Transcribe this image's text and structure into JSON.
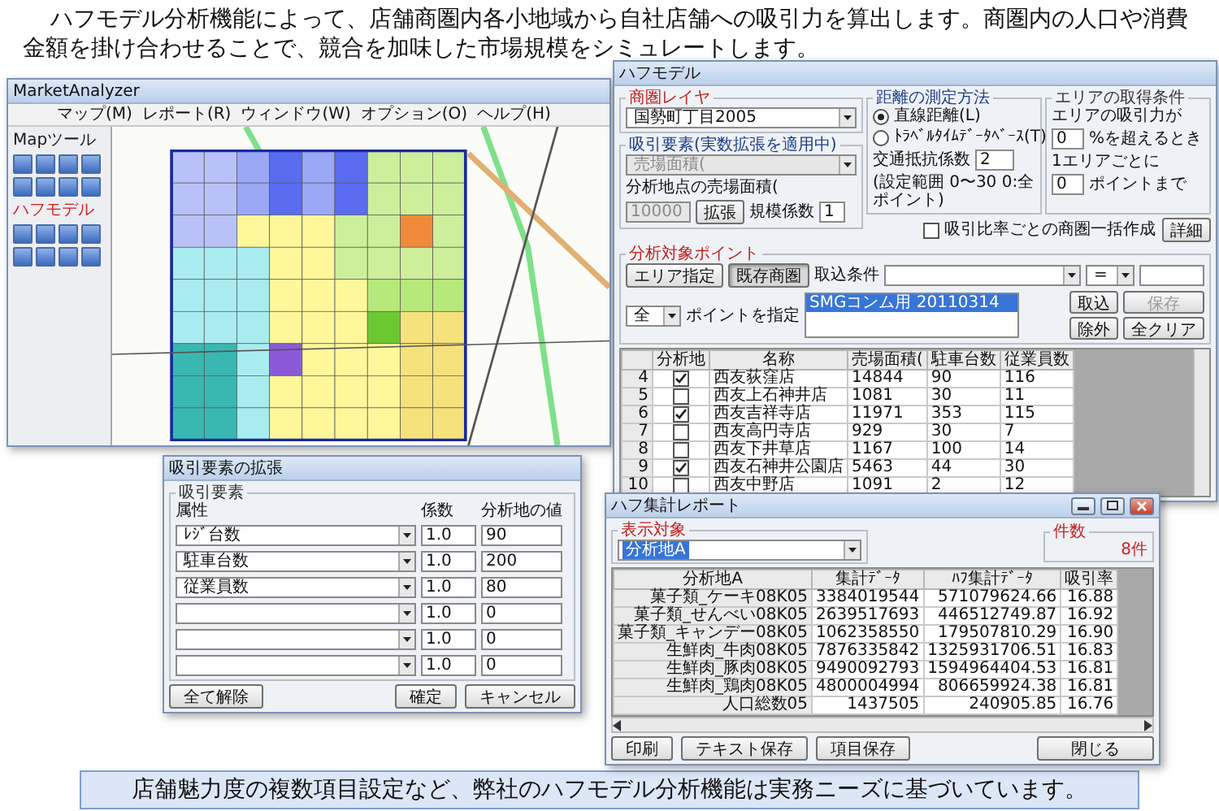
{
  "intro": "ハフモデル分析機能によって、店舗商圏内各小地域から自社店舗への吸引力を算出します。商圏内の人口や消費金額を掛け合わせることで、競合を加味した市場規模をシミュレートします。",
  "app_window": {
    "title": "MarketAnalyzer",
    "menu": [
      "マップ(M)",
      "レポート(R)",
      "ウィンドウ(W)",
      "オプション(O)",
      "ヘルプ(H)"
    ],
    "sidebar": [
      {
        "label": "Mapツール",
        "color": "#1a1a1a"
      },
      {
        "label": "ハフモデル",
        "color": "#d02020"
      }
    ]
  },
  "huff_dialog": {
    "title": "ハフモデル",
    "layer": {
      "legend": "商圏レイヤ",
      "value": "国勢町丁目2005"
    },
    "attraction": {
      "legend": "吸引要素(実数拡張を適用中)",
      "select_value": "売場面積(",
      "select_disabled": true,
      "area_label": "分析地点の売場面積(",
      "area_value": "10000",
      "area_disabled": true,
      "extend_button": "拡張",
      "scale_label": "規模係数",
      "scale_value": "1"
    },
    "distance": {
      "legend": "距離の測定方法",
      "options": [
        {
          "label": "直線距離(L)",
          "selected": true
        },
        {
          "label": "ﾄﾗﾍﾞﾙﾀｲﾑﾃﾞｰﾀﾍﾞｰｽ(T)",
          "selected": false
        }
      ],
      "resistance_label": "交通抵抗係数",
      "resistance_value": "2",
      "note": "(設定範囲 0〜30 0:全ポイント)"
    },
    "area_conditions": {
      "legend": "エリアの取得条件",
      "rows": [
        {
          "label": "エリアの吸引力が",
          "value": "0",
          "suffix": "%を超えるとき"
        },
        {
          "label": "1エリアごとに",
          "value": "0",
          "suffix": "ポイントまで"
        }
      ],
      "batch": {
        "label": "吸引比率ごとの商圏一括作成",
        "checked": false
      },
      "detail_button": "詳細"
    },
    "points": {
      "legend": "分析対象ポイント",
      "modes": [
        {
          "label": "エリア指定",
          "selected": false
        },
        {
          "label": "既存商圏",
          "selected": true
        }
      ],
      "condition_label": "取込条件",
      "operator": "=",
      "filter": "全",
      "filter_label": "ポイントを指定",
      "list": [
        {
          "label": "SMGコンム用 20110314",
          "selected": true
        }
      ],
      "buttons": [
        {
          "label": "取込",
          "disabled": false
        },
        {
          "label": "保存",
          "disabled": true
        },
        {
          "label": "除外",
          "disabled": false
        },
        {
          "label": "全クリア",
          "disabled": false
        }
      ]
    },
    "table": {
      "columns": [
        "",
        "分析地",
        "名称",
        "売場面積(",
        "駐車台数",
        "従業員数"
      ],
      "rows": [
        {
          "index": "4",
          "site": {
            "checked": true
          },
          "name": "西友荻窪店",
          "area": "14844",
          "parking": "90",
          "staff": "116"
        },
        {
          "index": "5",
          "site": {
            "checked": false
          },
          "name": "西友上石神井店",
          "area": "1081",
          "parking": "30",
          "staff": "11"
        },
        {
          "index": "6",
          "site": {
            "checked": true
          },
          "name": "西友吉祥寺店",
          "area": "11971",
          "parking": "353",
          "staff": "115"
        },
        {
          "index": "7",
          "site": {
            "checked": false
          },
          "name": "西友高円寺店",
          "area": "929",
          "parking": "30",
          "staff": "7"
        },
        {
          "index": "8",
          "site": {
            "checked": false
          },
          "name": "西友下井草店",
          "area": "1167",
          "parking": "100",
          "staff": "14"
        },
        {
          "index": "9",
          "site": {
            "checked": true
          },
          "name": "西友石神井公園店",
          "area": "5463",
          "parking": "44",
          "staff": "30"
        },
        {
          "index": "10",
          "site": {
            "checked": false
          },
          "name": "西友中野店",
          "area": "1091",
          "parking": "2",
          "staff": "12"
        }
      ]
    }
  },
  "extend_dialog": {
    "title": "吸引要素の拡張",
    "legend": "吸引要素",
    "columns": [
      "属性",
      "係数",
      "分析地の値"
    ],
    "rows": [
      {
        "attribute": "ﾚｼﾞ台数",
        "coef": "1.0",
        "value": "90"
      },
      {
        "attribute": "駐車台数",
        "coef": "1.0",
        "value": "200"
      },
      {
        "attribute": "従業員数",
        "coef": "1.0",
        "value": "80"
      },
      {
        "coef": "1.0",
        "value": "0"
      },
      {
        "coef": "1.0",
        "value": "0"
      },
      {
        "coef": "1.0",
        "value": "0"
      }
    ],
    "left_buttons": [
      "全て解除"
    ],
    "right_buttons": [
      "確定",
      "キャンセル"
    ]
  },
  "report_dialog": {
    "title": "ハフ集計レポート",
    "target_legend": "表示対象",
    "target_value": "分析地A",
    "count_legend": "件数",
    "count": "8件",
    "columns": [
      "分析地A",
      "集計ﾃﾞｰﾀ",
      "ﾊﾌ集計ﾃﾞｰﾀ",
      "吸引率"
    ],
    "rows": [
      {
        "name": "菓子類_ケーキ08K05",
        "total": "3384019544",
        "huff": "571079624.66",
        "rate": "16.88"
      },
      {
        "name": "菓子類_せんべい08K05",
        "total": "2639517693",
        "huff": "446512749.87",
        "rate": "16.92"
      },
      {
        "name": "菓子類_キャンデー08K05",
        "total": "1062358550",
        "huff": "179507810.29",
        "rate": "16.90"
      },
      {
        "name": "生鮮肉_牛肉08K05",
        "total": "7876335842",
        "huff": "1325931706.51",
        "rate": "16.83"
      },
      {
        "name": "生鮮肉_豚肉08K05",
        "total": "9490092793",
        "huff": "1594964404.53",
        "rate": "16.81"
      },
      {
        "name": "生鮮肉_鶏肉08K05",
        "total": "4800004994",
        "huff": "806659924.38",
        "rate": "16.81"
      },
      {
        "name": "人口総数05",
        "total": "1437505",
        "huff": "240905.85",
        "rate": "16.76"
      }
    ],
    "left_buttons": [
      "印刷",
      "テキスト保存",
      "項目保存"
    ],
    "right_buttons": [
      "閉じる"
    ]
  },
  "banner": "店舗魅力度の複数項目設定など、弊社のハフモデル分析機能は実務ニーズに基づいています。"
}
